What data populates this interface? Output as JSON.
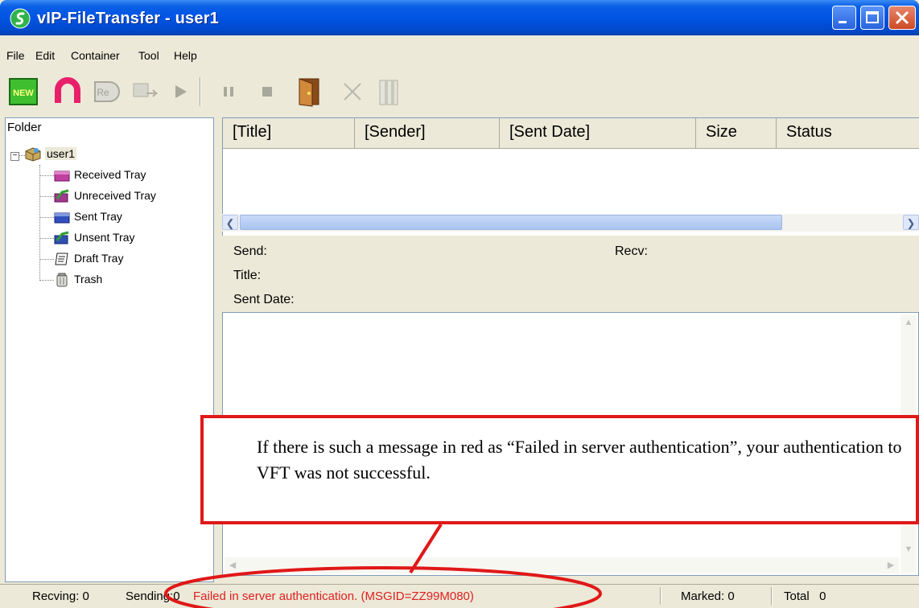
{
  "window": {
    "title": "vIP-FileTransfer - user1"
  },
  "menu": {
    "items": [
      "File",
      "Edit",
      "Container",
      "Tool",
      "Help"
    ]
  },
  "toolbar": {
    "buttons": [
      {
        "icon": "new-icon",
        "label": "NEW",
        "enabled": true
      },
      {
        "icon": "refresh-icon",
        "enabled": true
      },
      {
        "icon": "resend-icon",
        "label": "Re",
        "enabled": false
      },
      {
        "icon": "forward-icon",
        "enabled": false
      },
      {
        "icon": "play-icon",
        "enabled": false
      },
      {
        "icon": "pause-icon",
        "enabled": false
      },
      {
        "icon": "stop-icon",
        "enabled": false
      },
      {
        "icon": "exit-door-icon",
        "enabled": true
      },
      {
        "icon": "delete-x-icon",
        "enabled": false
      },
      {
        "icon": "archive-icon",
        "enabled": false
      }
    ]
  },
  "folders": {
    "header": "Folder",
    "root": {
      "label": "user1",
      "expander": "−"
    },
    "items": [
      {
        "label": "Received Tray",
        "icon": "received-tray-icon"
      },
      {
        "label": "Unreceived Tray",
        "icon": "unreceived-tray-icon"
      },
      {
        "label": "Sent Tray",
        "icon": "sent-tray-icon"
      },
      {
        "label": "Unsent Tray",
        "icon": "unsent-tray-icon"
      },
      {
        "label": "Draft Tray",
        "icon": "draft-tray-icon"
      },
      {
        "label": "Trash",
        "icon": "trash-icon"
      }
    ]
  },
  "message_list": {
    "columns": [
      "[Title]",
      "[Sender]",
      "[Sent Date]",
      "Size",
      "Status"
    ],
    "rows": []
  },
  "detail": {
    "send_label": "Send:",
    "recv_label": "Recv:",
    "title_label": "Title:",
    "sent_date_label": "Sent Date:"
  },
  "status": {
    "recving": "Recving: 0",
    "sending": "Sending:0",
    "error": "Failed in server authentication. (MSGID=ZZ99M080)",
    "marked": "Marked: 0",
    "total": "Total   0"
  },
  "annotation": {
    "text": "If there is such a message in red as “Failed in server authentication”, your authentication to VFT was not successful.",
    "color": "#e01818"
  },
  "colors": {
    "titlebar": "#0054e3",
    "error_text": "#e02020",
    "panel_bg": "#ece9d8"
  }
}
